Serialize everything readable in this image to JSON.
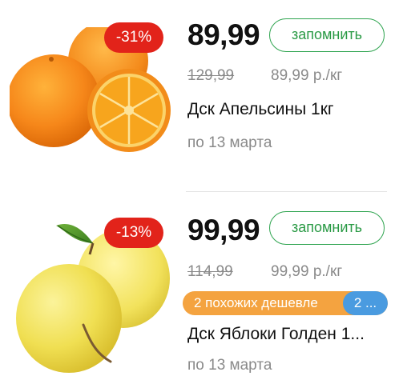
{
  "products": [
    {
      "discount": "-31%",
      "price": "89,99",
      "remember_label": "запомнить",
      "old_price": "129,99",
      "unit_price": "89,99 р./кг",
      "name": "Дск Апельсины 1кг",
      "valid_until": "по 13 марта",
      "image_icon": "orange-icon"
    },
    {
      "discount": "-13%",
      "price": "99,99",
      "remember_label": "запомнить",
      "old_price": "114,99",
      "unit_price": "99,99 р./кг",
      "similar_label": "2 похожих дешевле",
      "similar_count": "2 ...",
      "name": "Дск Яблоки Голден 1...",
      "valid_until": "по 13 марта",
      "image_icon": "apple-icon"
    }
  ],
  "colors": {
    "discount_badge": "#e2231a",
    "remember_border": "#2ea44f",
    "similar_bg": "#f4a340",
    "similar_pill": "#4a9be0"
  }
}
